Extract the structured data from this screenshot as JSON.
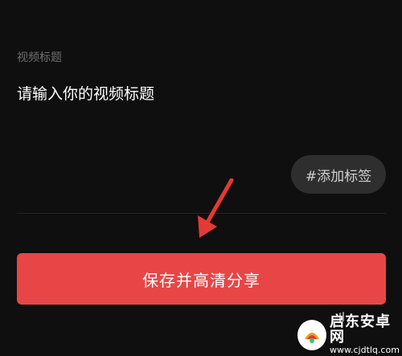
{
  "form": {
    "section_label": "视频标题",
    "title_placeholder": "请输入你的视频标题",
    "tag_button_label": "#添加标签"
  },
  "actions": {
    "save_share_label": "保存并高清分享"
  },
  "watermark": {
    "site_name": "启东安卓网",
    "site_url": "www.cjdtlq.com"
  },
  "colors": {
    "background": "#0f0f0f",
    "primary_button": "#e84646",
    "tag_chip": "#2e2e2e",
    "arrow": "#e53935"
  }
}
